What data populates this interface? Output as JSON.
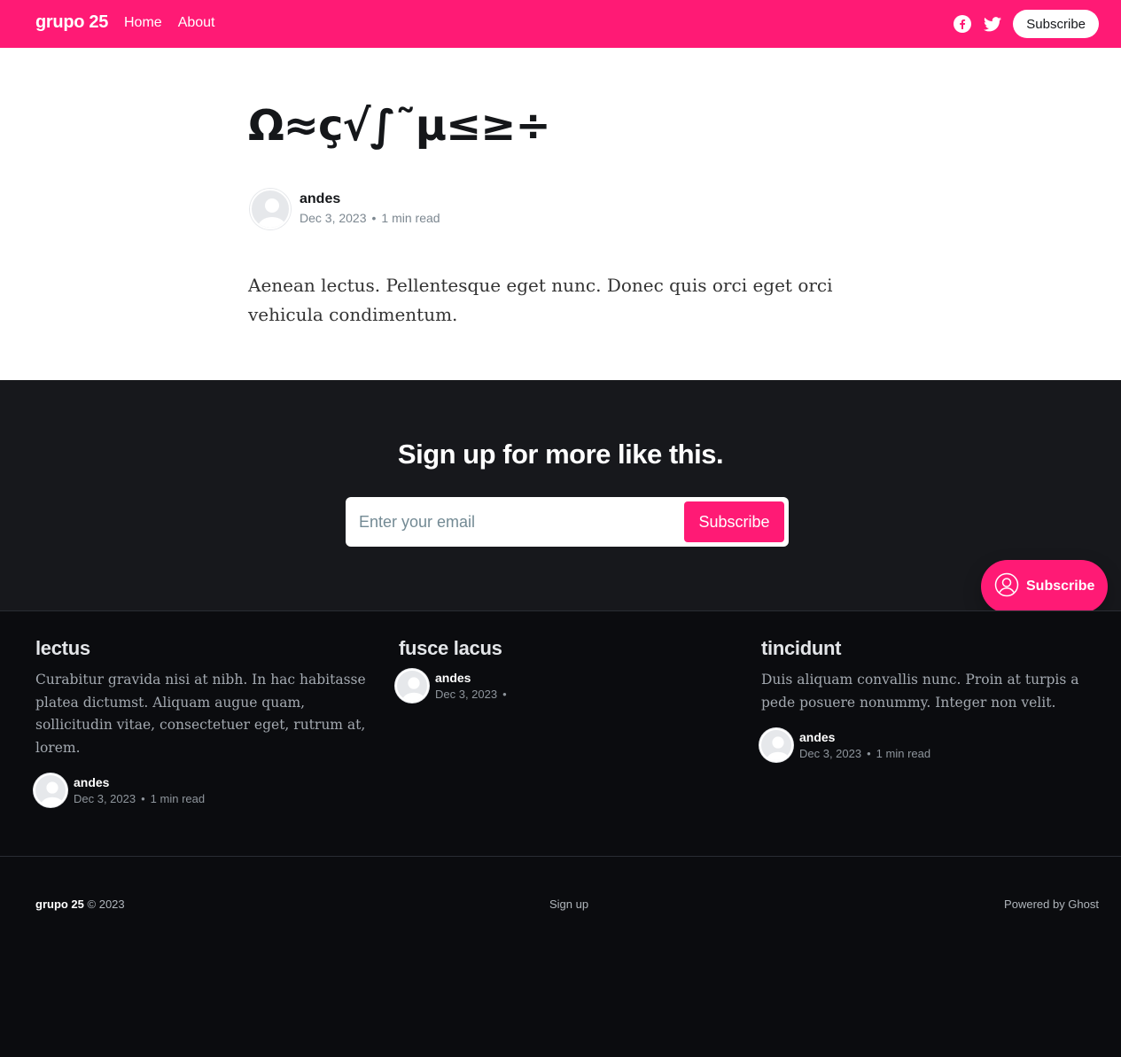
{
  "header": {
    "brand": "grupo 25",
    "nav": [
      {
        "label": "Home"
      },
      {
        "label": "About"
      }
    ],
    "subscribe_label": "Subscribe",
    "social_icons": [
      "facebook-icon",
      "twitter-icon"
    ]
  },
  "article": {
    "title": "Ω≈ç√∫˜µ≤≥÷",
    "author": "andes",
    "date": "Dec 3, 2023",
    "read_time": "1 min read",
    "body": "Aenean lectus. Pellentesque eget nunc. Donec quis orci eget orci vehicula condimentum."
  },
  "cta": {
    "title": "Sign up for more like this.",
    "email_placeholder": "Enter your email",
    "button_label": "Subscribe"
  },
  "portal": {
    "label": "Subscribe",
    "icon": "user-circle-icon"
  },
  "related": [
    {
      "title": "lectus",
      "excerpt": "Curabitur gravida nisi at nibh. In hac habitasse platea dictumst. Aliquam augue quam, sollicitudin vitae, consectetuer eget, rutrum at, lorem.",
      "author": "andes",
      "date": "Dec 3, 2023",
      "read_time": "1 min read"
    },
    {
      "title": "fusce lacus",
      "excerpt": "",
      "author": "andes",
      "date": "Dec 3, 2023",
      "read_time": ""
    },
    {
      "title": "tincidunt",
      "excerpt": "Duis aliquam convallis nunc. Proin at turpis a pede posuere nonummy. Integer non velit.",
      "author": "andes",
      "date": "Dec 3, 2023",
      "read_time": "1 min read"
    }
  ],
  "footer": {
    "brand": "grupo 25",
    "copyright": "© 2023",
    "signup_link": "Sign up",
    "powered_by": "Powered by Ghost"
  },
  "colors": {
    "accent": "#ff1a75",
    "dark_bg": "#17181c",
    "footer_bg": "#0b0c0f"
  }
}
